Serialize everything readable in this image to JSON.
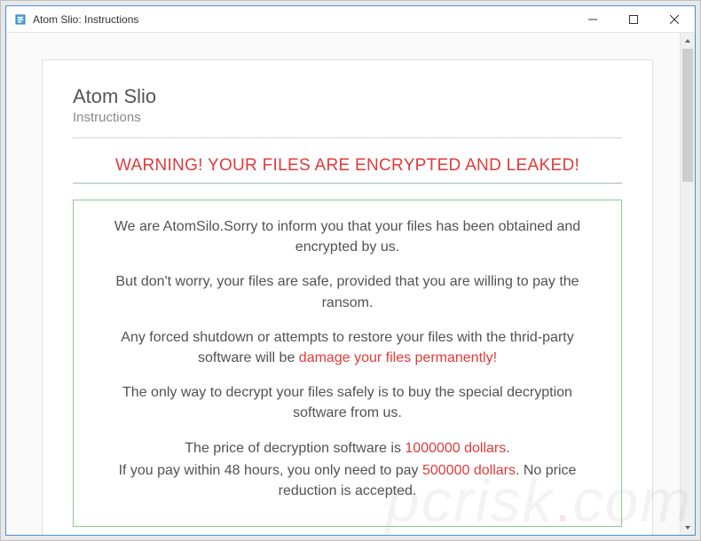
{
  "window": {
    "title": "Atom Slio: Instructions"
  },
  "page": {
    "title": "Atom Slio",
    "subtitle": "Instructions",
    "warning": "WARNING! YOUR FILES ARE ENCRYPTED AND LEAKED!"
  },
  "body": {
    "p1": "We are AtomSilo.Sorry to inform you that your files has been obtained and encrypted by us.",
    "p2": "But don't worry, your files are safe, provided that you are willing to pay the ransom.",
    "p3_a": "Any forced shutdown or attempts to restore your files with the thrid-party software will be ",
    "p3_red": "damage your files permanently!",
    "p4": "The only way to decrypt your files safely is to buy the special decryption software from us.",
    "p5_a": "The price of decryption software is ",
    "p5_red": "1000000 dollars",
    "p5_b": ".",
    "p6_a": "If you pay within 48 hours, you only need to pay ",
    "p6_red": "500000 dollars",
    "p6_b": ". No price reduction is accepted."
  },
  "watermark": {
    "text_a": "pcrisk",
    "dot": ".",
    "text_b": "com"
  }
}
